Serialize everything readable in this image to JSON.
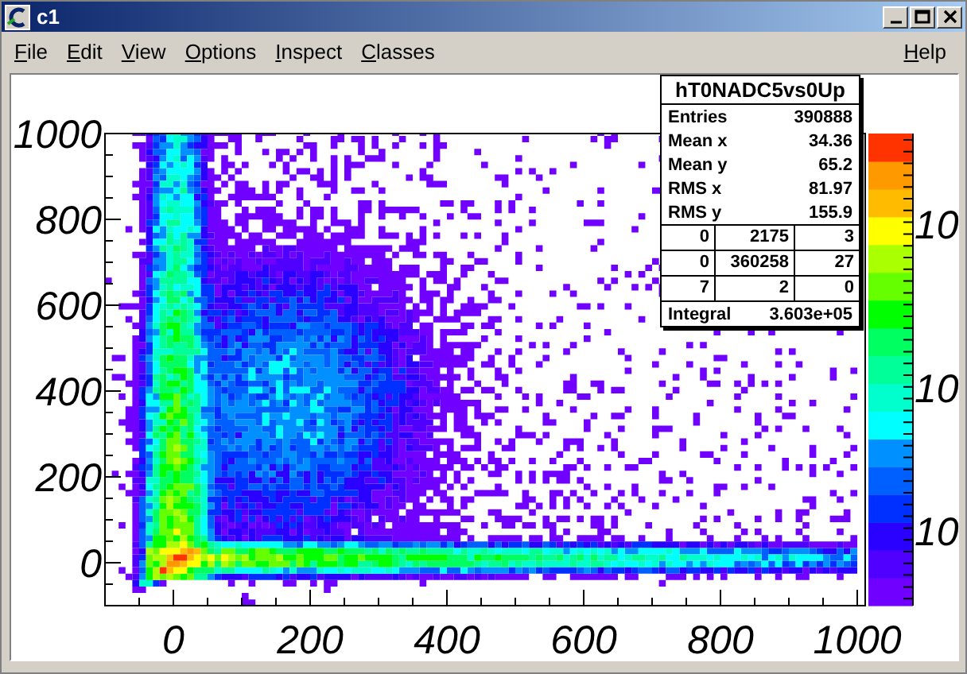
{
  "window": {
    "title": "c1"
  },
  "menu": [
    {
      "label": "File"
    },
    {
      "label": "Edit"
    },
    {
      "label": "View"
    },
    {
      "label": "Options"
    },
    {
      "label": "Inspect"
    },
    {
      "label": "Classes"
    },
    {
      "label": "Help"
    }
  ],
  "plot": {
    "x_tick_labels": [
      "0",
      "200",
      "400",
      "600",
      "800",
      "1000"
    ],
    "y_tick_labels": [
      "1000",
      "800",
      "600",
      "400",
      "200",
      "0"
    ],
    "palette_labels": [
      "10",
      "10",
      "10"
    ]
  },
  "stats": {
    "title": "hT0NADC5vs0Up",
    "rows": [
      {
        "label": "Entries",
        "value": "390888"
      },
      {
        "label": "Mean x",
        "value": "34.36"
      },
      {
        "label": "Mean y",
        "value": "65.2"
      },
      {
        "label": "RMS x",
        "value": "81.97"
      },
      {
        "label": "RMS y",
        "value": "155.9"
      }
    ],
    "grid": [
      [
        "0",
        "2175",
        "3"
      ],
      [
        "0",
        "360258",
        "27"
      ],
      [
        "7",
        "2",
        "0"
      ]
    ],
    "integral": {
      "label": "Integral",
      "value": "3.603e+05"
    }
  }
}
